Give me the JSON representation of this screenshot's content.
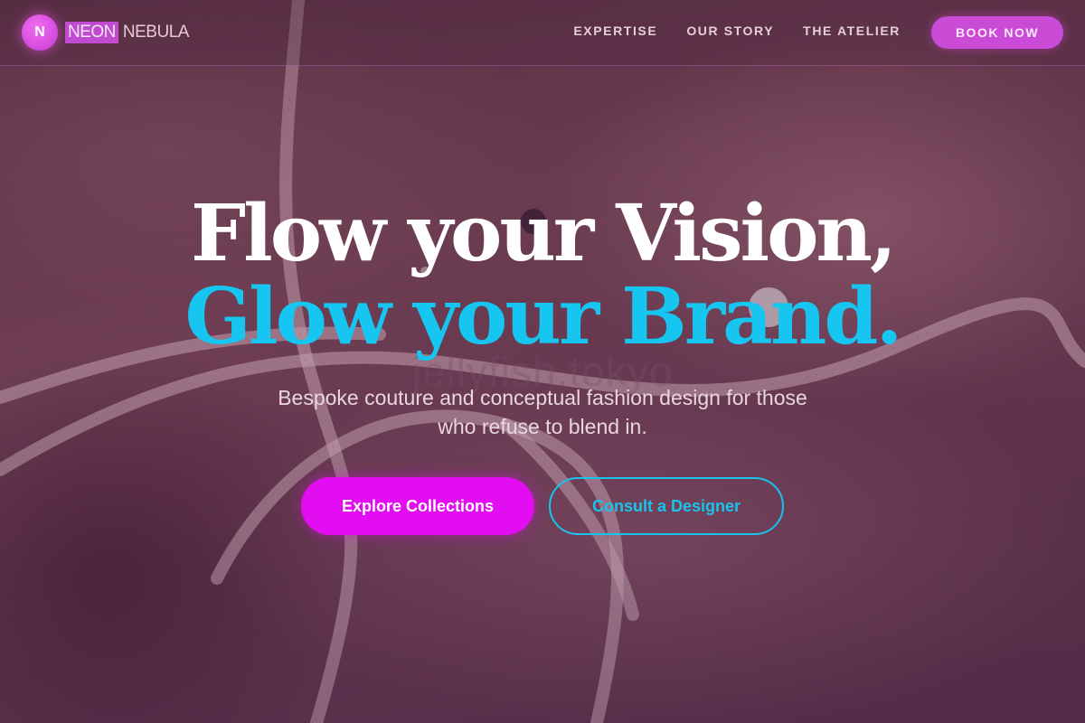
{
  "brand": {
    "mark": "N",
    "name_highlight": "NEON",
    "name_rest": "NEBULA"
  },
  "nav": {
    "links": [
      "EXPERTISE",
      "OUR STORY",
      "THE ATELIER"
    ],
    "cta": "BOOK NOW"
  },
  "hero": {
    "headline_line1": "Flow your Vision,",
    "headline_line2": "Glow your Brand.",
    "watermark": "jellyfish.tokyo",
    "subtitle": "Bespoke couture and conceptual fashion design for those who refuse to blend in.",
    "primary_cta": "Explore Collections",
    "secondary_cta": "Consult a Designer"
  },
  "colors": {
    "accent_magenta": "#e20df0",
    "accent_cyan": "#16c5f0",
    "brand_pink": "#c94bd6"
  },
  "icons": {
    "logo": "logo-mark-icon"
  }
}
